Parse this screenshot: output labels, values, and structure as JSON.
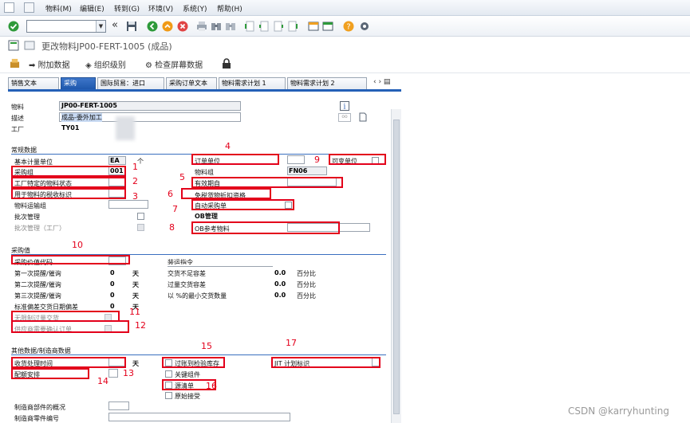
{
  "menubar": {
    "items": [
      "物料(M)",
      "编辑(E)",
      "转到(G)",
      "环境(V)",
      "系统(Y)",
      "帮助(H)"
    ]
  },
  "window": {
    "title": "更改物料JP00-FERT-1005 (成品)"
  },
  "apptoolbar": {
    "additional_data": "附加数据",
    "org_levels": "组织级别",
    "check_screen_data": "检查屏幕数据"
  },
  "tabs": [
    {
      "label": "销售文本",
      "active": false
    },
    {
      "label": "采购",
      "active": true
    },
    {
      "label": "国际贸易：进口",
      "active": false
    },
    {
      "label": "采购订单文本",
      "active": false
    },
    {
      "label": "物料需求计划 1",
      "active": false
    },
    {
      "label": "物料需求计划 2",
      "active": false
    }
  ],
  "header": {
    "material_label": "物料",
    "material_value": "JP00-FERT-1005",
    "desc_label": "描述",
    "desc_value": "成品-委外加工",
    "plant_label": "工厂",
    "plant_value": "TY01"
  },
  "general": {
    "section_title": "常规数据",
    "base_uom_label": "基本计量单位",
    "base_uom_value": "EA",
    "base_uom_text": "个",
    "purch_group_label": "采购组",
    "purch_group_value": "001",
    "plant_status_label": "工厂特定的物料状态",
    "tax_ind_label": "用于物料的税收标识",
    "transport_group_label": "物料运输组",
    "batch_mgmt_label": "批次管理",
    "batch_mgmt_plant_label": "批次管理（工厂）",
    "order_unit_label": "订单单位",
    "var_unit_label": "可变单位",
    "mat_group_label": "物料组",
    "mat_group_value": "FN06",
    "valid_from_label": "有效期自",
    "tax_exempt_label": "免税货物折扣资格",
    "auto_po_label": "自动采购单",
    "ob_mgmt_label": "OB管理",
    "ob_ref_label": "OB参考物料"
  },
  "purch_values": {
    "section_title": "采购值",
    "value_key_label": "采购价值代码",
    "reminder1_label": "第一次提醒/催询",
    "reminder1_value": "0",
    "reminder2_label": "第二次提醒/催询",
    "reminder2_value": "0",
    "reminder3_label": "第三次提醒/催询",
    "reminder3_value": "0",
    "std_dev_label": "标准偏差交货日期偏差",
    "std_dev_value": "0",
    "days_unit": "天",
    "unlimited_label": "无限制过量交货",
    "ack_label": "供应商需要确认订单",
    "shipping_instr_label": "装运指令",
    "underdel_label": "交货不足容差",
    "underdel_value": "0.0",
    "overdel_label": "过量交货容差",
    "overdel_value": "0.0",
    "min_qty_label": "以 %的最小交货数量",
    "min_qty_value": "0.0",
    "percent_unit": "百分比"
  },
  "other": {
    "section_title": "其他数据/制造商数据",
    "gr_time_label": "收货处理时间",
    "days_unit": "天",
    "quota_label": "配额安排",
    "post_to_insp_label": "过账到检验库存",
    "critical_part_label": "关键组件",
    "source_list_label": "源清单",
    "jit_label": "JIT 计划标识",
    "orig_accept_label": "原始接受",
    "mfr_part_profile_label": "制造商部件的概况",
    "mfr_part_no_label": "制造商零件编号"
  },
  "annotations": [
    "1",
    "2",
    "3",
    "4",
    "5",
    "6",
    "7",
    "8",
    "9",
    "10",
    "11",
    "12",
    "13",
    "14",
    "15",
    "16",
    "17"
  ],
  "watermark": "CSDN @karryhunting",
  "colors": {
    "highlight": "#e3001b",
    "tab_active": "#2460b7",
    "section_line": "#3a6fbf"
  }
}
